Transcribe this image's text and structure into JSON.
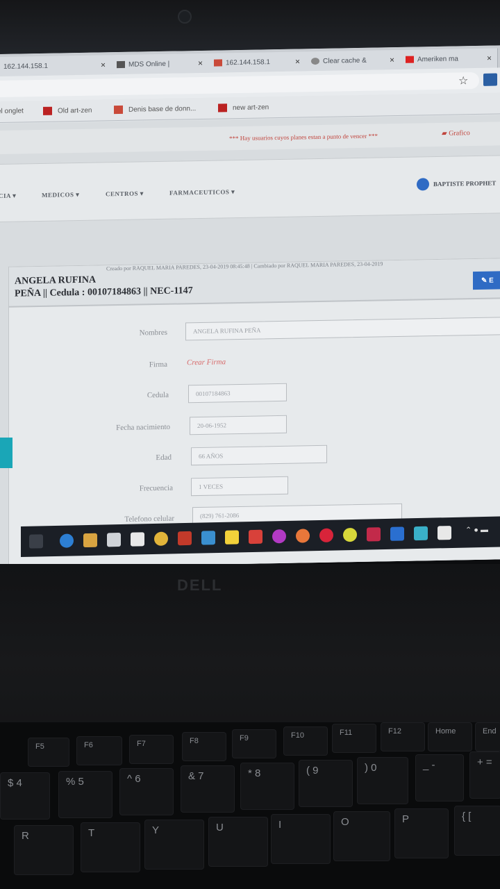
{
  "browser": {
    "tabs": [
      {
        "label": "162.144.158.1",
        "close": "×"
      },
      {
        "label": "MDS Online |",
        "close": "×"
      },
      {
        "label": "162.144.158.1",
        "close": "×"
      },
      {
        "label": "Clear cache &",
        "close": "×"
      },
      {
        "label": "Ameriken ma",
        "close": "×"
      }
    ],
    "bookmarks": [
      "el onglet",
      "Old art-zen",
      "Denis base de donn...",
      "new art-zen"
    ]
  },
  "site": {
    "alert": "*** Hay usuarios cuyos planes estan a punto de vencer ***",
    "grafico": "Grafico",
    "nav": [
      "CIA ▾",
      "MEDICOS ▾",
      "CENTROS ▾",
      "FARMACEUTICOS ▾"
    ],
    "user": "BAPTISTE PROPHET"
  },
  "record": {
    "created": "Creado por RAQUEL MARIA PAREDES, 23-04-2019 08:45:48 | Cambiado por RAQUEL MARIA PAREDES, 23-04-2019",
    "title_line1": "ANGELA RUFINA",
    "title_line2": "PEÑA || Cedula : 00107184863 || NEC-1147",
    "edit_label": "✎ E",
    "fields": {
      "nombres_label": "Nombres",
      "nombres_value": "ANGELA RUFINA PEÑA",
      "firma_label": "Firma",
      "firma_value": "Crear Firma",
      "cedula_label": "Cedula",
      "cedula_value": "00107184863",
      "fecha_label": "Fecha nacimiento",
      "fecha_value": "20-06-1952",
      "edad_label": "Edad",
      "edad_value": "66 AÑOS",
      "frecuencia_label": "Frecuencia",
      "frecuencia_value": "1 VECES",
      "telefono_label": "Telefono celular",
      "telefono_value": "(829) 761-2086"
    }
  },
  "laptop": {
    "brand": "DELL",
    "fkeys": [
      "F5",
      "F6",
      "F7",
      "F8",
      "F9",
      "F10",
      "F11",
      "F12",
      "Home",
      "End"
    ],
    "numkeys": [
      "$ 4",
      "% 5",
      "^ 6",
      "& 7",
      "* 8",
      "( 9",
      ") 0",
      "_ -",
      "+ ="
    ],
    "letters": [
      "R",
      "T",
      "Y",
      "U",
      "I",
      "O",
      "P",
      "{ ["
    ]
  }
}
